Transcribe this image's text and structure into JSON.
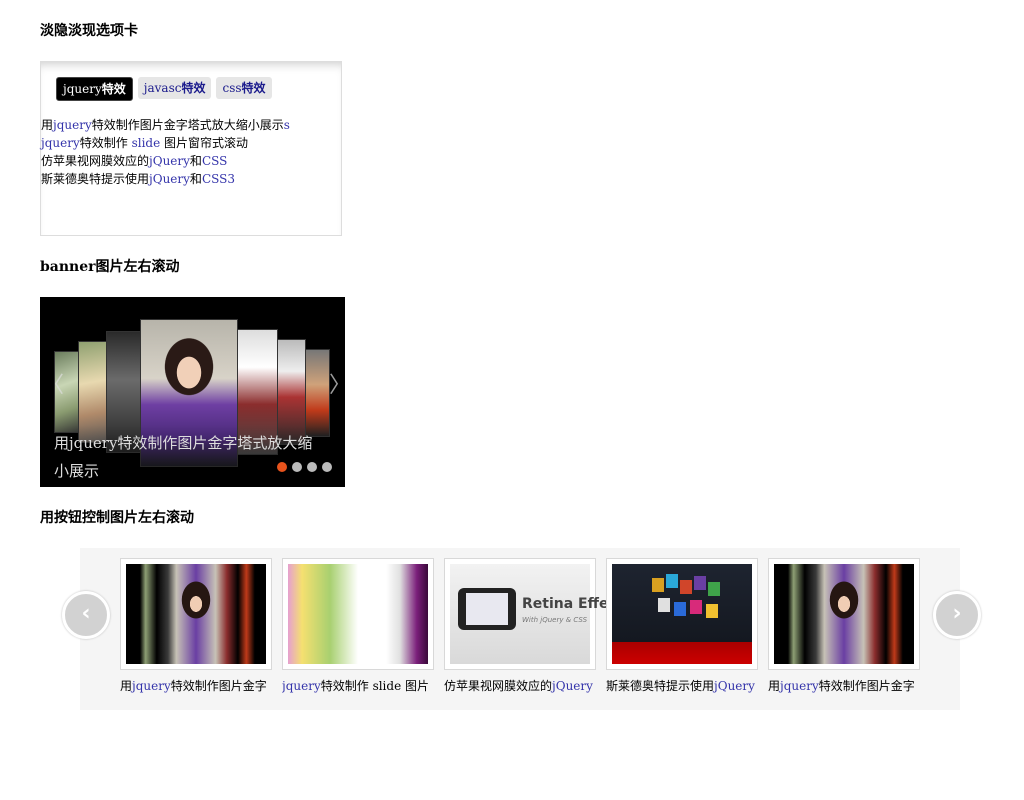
{
  "sections": {
    "tabs_title": "淡隐淡现选项卡",
    "banner_title": "banner图片左右滚动",
    "carousel_title": "用按钮控制图片左右滚动"
  },
  "tabbox": {
    "tabs": [
      {
        "latin": "jquery",
        "cjk": "特效"
      },
      {
        "latin": "javasc",
        "cjk": "特效"
      },
      {
        "latin": "css",
        "cjk": "特效"
      }
    ],
    "items": [
      {
        "pre": "用",
        "en": "jquery",
        "mid": "特效制作图片金字塔式放大缩小展示",
        "tail": "s"
      },
      {
        "pre": "",
        "en": "jquery",
        "mid": "特效制作 ",
        "tail": "slide",
        "post": " 图片窗帘式滚动"
      },
      {
        "pre": "仿苹果视网膜效应的",
        "en": "jQuery",
        "mid": "和",
        "tail": "CSS"
      },
      {
        "pre": "斯莱德奥特提示使用",
        "en": "jQuery",
        "mid": "和",
        "tail": "CSS3"
      }
    ]
  },
  "banner": {
    "caption": "用jquery特效制作图片金字塔式放大缩小展示",
    "prev_glyph": "〈",
    "next_glyph": "〉",
    "active_dot": 0,
    "dot_count": 4,
    "accent_color": "#e8531c"
  },
  "carousel": {
    "prev_glyph": "‹",
    "next_glyph": "›",
    "retina_title": "Retina Effect",
    "retina_sub": "With jQuery & CSS",
    "cards": [
      {
        "pre": "用",
        "en": "jquery",
        "post": "特效制作图片金字"
      },
      {
        "pre": "",
        "en": "jquery",
        "post": "特效制作 slide 图片"
      },
      {
        "pre": "仿苹果视网膜效应的",
        "en": "jQuery",
        "post": ""
      },
      {
        "pre": "斯莱德奥特提示使用",
        "en": "jQuery",
        "post": ""
      },
      {
        "pre": "用",
        "en": "jquery",
        "post": "特效制作图片金字"
      }
    ]
  }
}
